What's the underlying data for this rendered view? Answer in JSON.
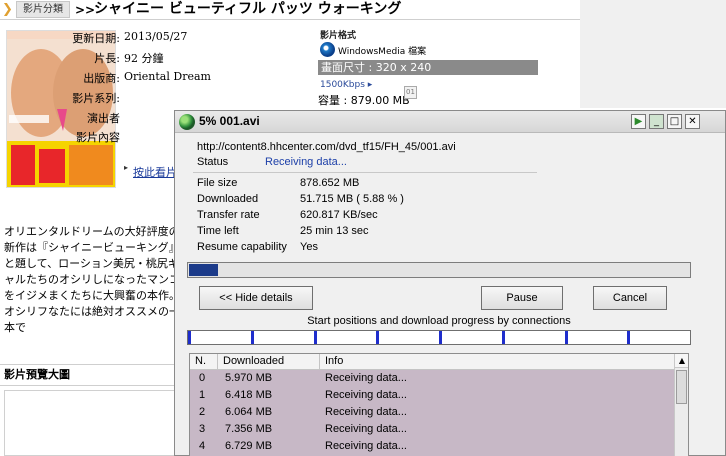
{
  "page": {
    "category_tab": "影片分類",
    "breadcrumb_sep": ">>",
    "title": "シャイニー ビューティフル パッツ ウォーキング",
    "meta": [
      {
        "label": "更新日期:",
        "value": "2013/05/27"
      },
      {
        "label": "片長:",
        "value": "92 分鐘"
      },
      {
        "label": "出版商:",
        "value": "Oriental Dream"
      },
      {
        "label": "影片系列:",
        "value": ""
      },
      {
        "label": "演出者",
        "value": ""
      },
      {
        "label": "影片內容",
        "value": ""
      }
    ],
    "format": {
      "section_title": "影片格式",
      "player_label": "WindowsMedia 檔案",
      "resolution": "畫面尺寸 : 320 x 240",
      "bitrate": "1500Kbps ▸",
      "size": "容量 : 879.00 MB"
    },
    "buy_link": "按此看片",
    "description": "オリエンタルドリームの大好評度の新作は『シャイニービューキング』と題して、ローション美尻・桃尻ギャルたちのオシリしになったマンコをイジメまくたちに大興奮の本作。オシリフなたには絶対オススメの一本で",
    "preview_section": "影片預覽大圖"
  },
  "dialog": {
    "title": "5% 001.avi",
    "url": "http://content8.hhcenter.com/dvd_tf15/FH_45/001.avi",
    "status_label": "Status",
    "status_value": "Receiving data...",
    "info": [
      {
        "label": "File size",
        "value": "878.652  MB"
      },
      {
        "label": "Downloaded",
        "value": "51.715  MB  ( 5.88 % )"
      },
      {
        "label": "Transfer rate",
        "value": "620.817  KB/sec"
      },
      {
        "label": "Time left",
        "value": "25 min 13 sec"
      },
      {
        "label": "Resume capability",
        "value": "Yes"
      }
    ],
    "progress_fraction": 0.0588,
    "buttons": {
      "hide_details": "<< Hide details",
      "pause": "Pause",
      "cancel": "Cancel"
    },
    "connections_caption": "Start positions and download progress by connections",
    "connections_count": 8,
    "list": {
      "columns": [
        "N.",
        "Downloaded",
        "Info"
      ],
      "rows": [
        {
          "n": "0",
          "downloaded": "5.970  MB",
          "info": "Receiving data..."
        },
        {
          "n": "1",
          "downloaded": "6.418  MB",
          "info": "Receiving data..."
        },
        {
          "n": "2",
          "downloaded": "6.064  MB",
          "info": "Receiving data..."
        },
        {
          "n": "3",
          "downloaded": "7.356  MB",
          "info": "Receiving data..."
        },
        {
          "n": "4",
          "downloaded": "6.729  MB",
          "info": "Receiving data..."
        }
      ]
    }
  },
  "colors": {
    "progress_fill": "#1c3b8a",
    "connection_marker": "#1e2dcc",
    "list_selection": "#c7b8c6",
    "status_text": "#1c3fa8"
  },
  "icons": [
    "chevron-icon",
    "windows-media-icon",
    "download-manager-icon",
    "play-icon",
    "minimize-icon",
    "maximize-icon",
    "close-icon",
    "scroll-up-icon"
  ]
}
